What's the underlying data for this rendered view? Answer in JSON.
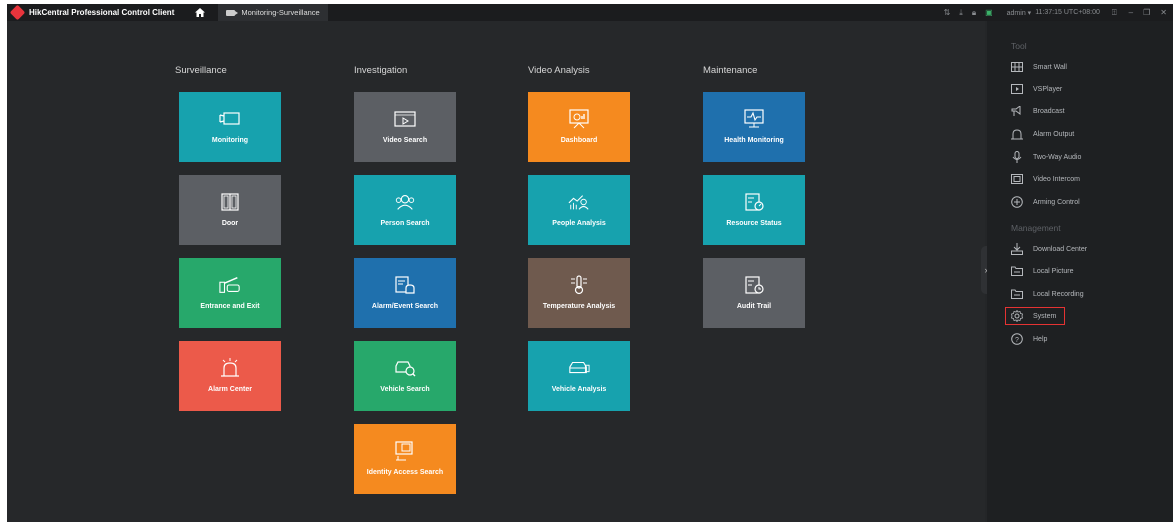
{
  "app": {
    "title": "HikCentral Professional Control Client",
    "tab": "Monitoring-Surveillance"
  },
  "topbar": {
    "user": "admin",
    "time": "11:37:15 UTC+08:00",
    "icons": [
      "sort-icon",
      "download-icon",
      "lock-icon",
      "monitor-icon",
      "lock-screen-icon",
      "minimize-icon",
      "restore-icon",
      "close-icon"
    ]
  },
  "columns": {
    "surveillance": "Surveillance",
    "investigation": "Investigation",
    "video_analysis": "Video Analysis",
    "maintenance": "Maintenance"
  },
  "tiles": {
    "monitoring": "Monitoring",
    "door": "Door",
    "entrance_exit": "Entrance and Exit",
    "alarm_center": "Alarm Center",
    "video_search": "Video Search",
    "person_search": "Person Search",
    "alarm_event_search": "Alarm/Event Search",
    "vehicle_search": "Vehicle Search",
    "identity_access_search": "Identity Access Search",
    "dashboard": "Dashboard",
    "people_analysis": "People Analysis",
    "temperature_analysis": "Temperature Analysis",
    "vehicle_analysis": "Vehicle Analysis",
    "health_monitoring": "Health Monitoring",
    "resource_status": "Resource Status",
    "audit_trail": "Audit Trail"
  },
  "colors": {
    "teal": "#17a2ae",
    "gray": "#5c5f64",
    "green": "#27a86b",
    "red": "#ec5a4a",
    "orange": "#f58a1f",
    "blue": "#1f70ad",
    "brown": "#6f5a4e"
  },
  "panel": {
    "tool_title": "Tool",
    "tools": {
      "smart_wall": "Smart Wall",
      "vsplayer": "VSPlayer",
      "broadcast": "Broadcast",
      "alarm_output": "Alarm Output",
      "two_way_audio": "Two-Way Audio",
      "video_intercom": "Video Intercom",
      "arming_control": "Arming Control"
    },
    "management_title": "Management",
    "management": {
      "download_center": "Download Center",
      "local_picture": "Local Picture",
      "local_recording": "Local Recording",
      "system": "System",
      "help": "Help"
    }
  }
}
